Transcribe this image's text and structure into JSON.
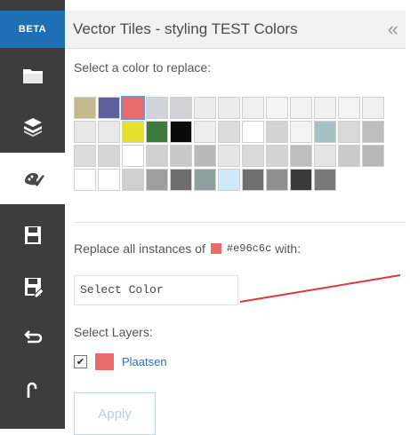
{
  "rail": {
    "badge": "BETA",
    "buttons": [
      {
        "name": "open-folder-icon",
        "active": false
      },
      {
        "name": "layers-icon",
        "active": false
      },
      {
        "name": "palette-brush-icon",
        "active": true
      },
      {
        "name": "save-icon",
        "active": false
      },
      {
        "name": "save-as-icon",
        "active": false
      },
      {
        "name": "undo-icon",
        "active": false
      },
      {
        "name": "redo-icon",
        "active": false
      }
    ]
  },
  "panel": {
    "title": "Vector Tiles - styling TEST Colors",
    "collapse_glyph": "«",
    "prompt": "Select a color to replace:",
    "selected_index": 2,
    "palette": [
      "#c4b98e",
      "#5e5f9c",
      "#e96c6c",
      "#d3d3db",
      "#d2d2d6",
      "#ececec",
      "#ececec",
      "#f0f0f0",
      "#f4f4f4",
      "#f2f2f2",
      "#f1f1f1",
      "#f3f3f3",
      "#f0f0f0",
      "#e7e7e7",
      "#e9e9e9",
      "#e5e02d",
      "#3d7a3d",
      "#0a0a0a",
      "#ededed",
      "#dcdcdc",
      "#ffffff",
      "#d4d4d4",
      "#f3f3f3",
      "#a5c1c3",
      "#d8d8d8",
      "#bdbdbd",
      "#dcdcdc",
      "#d6d6d6",
      "#ffffff",
      "#d0d0d0",
      "#c8c8c8",
      "#b9b9b9",
      "#e6e6e6",
      "#d8d8d8",
      "#d4d4d4",
      "#bdbdbd",
      "#e5e5e5",
      "#cbcbcb",
      "#b7b7b7",
      "#ffffff",
      "#ffffff",
      "#cfcfcf",
      "#9f9f9f",
      "#6e6e6e",
      "#8d9f9f",
      "#cde9fb",
      "#6f6f6f",
      "#8f8f8f",
      "#3a3a3a",
      "#7a7a7a"
    ],
    "replace": {
      "prefix": "Replace all instances of",
      "swatch_color": "#e96c6c",
      "hex": "#e96c6c",
      "suffix": "with:"
    },
    "select_color_placeholder": "Select Color",
    "select_layers_label": "Select Layers:",
    "layers": [
      {
        "checked": true,
        "color": "#e96c6c",
        "name": "Plaatsen"
      }
    ],
    "apply_label": "Apply",
    "annotation_color": "#e0363e"
  }
}
